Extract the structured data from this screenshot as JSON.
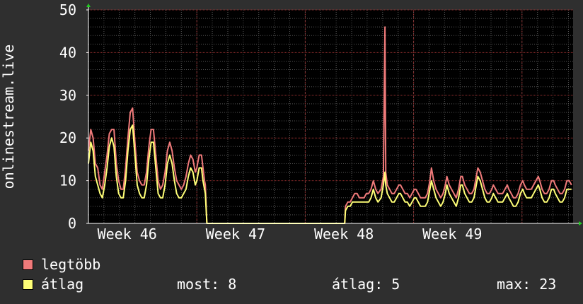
{
  "chart_data": {
    "type": "line",
    "ylabel": "onlinestream.live",
    "ylim": [
      0,
      50
    ],
    "yticks": [
      0,
      10,
      20,
      30,
      40,
      50
    ],
    "x_range": [
      0,
      28
    ],
    "week_ticks": [
      {
        "label": "Week 46",
        "x": 2.5
      },
      {
        "label": "Week 47",
        "x": 9.5
      },
      {
        "label": "Week 48",
        "x": 16.5
      },
      {
        "label": "Week 49",
        "x": 23.5
      }
    ],
    "grid": true,
    "series": [
      {
        "name": "legtöbb",
        "color": "#f07a7a",
        "points": [
          [
            0.0,
            17
          ],
          [
            0.15,
            22
          ],
          [
            0.3,
            20
          ],
          [
            0.45,
            14
          ],
          [
            0.6,
            13
          ],
          [
            0.75,
            9
          ],
          [
            0.9,
            8
          ],
          [
            1.05,
            12
          ],
          [
            1.2,
            16
          ],
          [
            1.35,
            21
          ],
          [
            1.5,
            22
          ],
          [
            1.65,
            22
          ],
          [
            1.8,
            14
          ],
          [
            1.95,
            10
          ],
          [
            2.1,
            8
          ],
          [
            2.25,
            8
          ],
          [
            2.4,
            13
          ],
          [
            2.55,
            20
          ],
          [
            2.7,
            26
          ],
          [
            2.85,
            27
          ],
          [
            3.0,
            19
          ],
          [
            3.15,
            12
          ],
          [
            3.3,
            10
          ],
          [
            3.45,
            9
          ],
          [
            3.6,
            9
          ],
          [
            3.75,
            12
          ],
          [
            3.9,
            18
          ],
          [
            4.05,
            22
          ],
          [
            4.2,
            22
          ],
          [
            4.35,
            16
          ],
          [
            4.5,
            10
          ],
          [
            4.65,
            8
          ],
          [
            4.8,
            9
          ],
          [
            4.95,
            12
          ],
          [
            5.1,
            17
          ],
          [
            5.25,
            19
          ],
          [
            5.4,
            17
          ],
          [
            5.55,
            13
          ],
          [
            5.7,
            10
          ],
          [
            5.85,
            9
          ],
          [
            6.0,
            8
          ],
          [
            6.15,
            9
          ],
          [
            6.3,
            11
          ],
          [
            6.45,
            14
          ],
          [
            6.6,
            16
          ],
          [
            6.75,
            15
          ],
          [
            6.9,
            12
          ],
          [
            7.0,
            13
          ],
          [
            7.15,
            16
          ],
          [
            7.3,
            16
          ],
          [
            7.4,
            13
          ],
          [
            7.5,
            10
          ],
          [
            7.55,
            9
          ],
          [
            7.65,
            0
          ],
          [
            8.0,
            0
          ],
          [
            10.0,
            0
          ],
          [
            12.0,
            0
          ],
          [
            14.0,
            0
          ],
          [
            16.0,
            0
          ],
          [
            16.55,
            0
          ],
          [
            16.6,
            4
          ],
          [
            16.75,
            5
          ],
          [
            16.9,
            5
          ],
          [
            17.05,
            6
          ],
          [
            17.2,
            7
          ],
          [
            17.35,
            7
          ],
          [
            17.5,
            6
          ],
          [
            17.65,
            6
          ],
          [
            17.8,
            6
          ],
          [
            17.95,
            7
          ],
          [
            18.1,
            7
          ],
          [
            18.25,
            8
          ],
          [
            18.4,
            10
          ],
          [
            18.55,
            8
          ],
          [
            18.7,
            7
          ],
          [
            18.9,
            8
          ],
          [
            19.05,
            11
          ],
          [
            19.15,
            46
          ],
          [
            19.2,
            12
          ],
          [
            19.3,
            9
          ],
          [
            19.45,
            8
          ],
          [
            19.6,
            7
          ],
          [
            19.75,
            7
          ],
          [
            19.9,
            8
          ],
          [
            20.05,
            9
          ],
          [
            20.15,
            9
          ],
          [
            20.3,
            8
          ],
          [
            20.45,
            7
          ],
          [
            20.6,
            7
          ],
          [
            20.75,
            6
          ],
          [
            20.9,
            7
          ],
          [
            21.05,
            8
          ],
          [
            21.15,
            8
          ],
          [
            21.3,
            7
          ],
          [
            21.45,
            6
          ],
          [
            21.6,
            6
          ],
          [
            21.75,
            6
          ],
          [
            21.9,
            7
          ],
          [
            22.05,
            10
          ],
          [
            22.15,
            13
          ],
          [
            22.3,
            10
          ],
          [
            22.45,
            8
          ],
          [
            22.6,
            7
          ],
          [
            22.75,
            6
          ],
          [
            22.9,
            7
          ],
          [
            23.05,
            9
          ],
          [
            23.15,
            11
          ],
          [
            23.3,
            9
          ],
          [
            23.45,
            8
          ],
          [
            23.6,
            7
          ],
          [
            23.75,
            6
          ],
          [
            23.9,
            8
          ],
          [
            24.05,
            11
          ],
          [
            24.15,
            11
          ],
          [
            24.3,
            9
          ],
          [
            24.45,
            8
          ],
          [
            24.6,
            7
          ],
          [
            24.75,
            7
          ],
          [
            24.9,
            8
          ],
          [
            25.05,
            11
          ],
          [
            25.15,
            13
          ],
          [
            25.3,
            12
          ],
          [
            25.45,
            10
          ],
          [
            25.6,
            8
          ],
          [
            25.75,
            7
          ],
          [
            25.9,
            7
          ],
          [
            26.05,
            8
          ],
          [
            26.15,
            9
          ],
          [
            26.3,
            8
          ],
          [
            26.45,
            7
          ],
          [
            26.6,
            7
          ],
          [
            26.75,
            7
          ],
          [
            26.9,
            8
          ],
          [
            27.05,
            9
          ],
          [
            27.15,
            8
          ],
          [
            27.3,
            7
          ],
          [
            27.45,
            6
          ],
          [
            27.6,
            6
          ],
          [
            27.75,
            7
          ],
          [
            27.9,
            9
          ],
          [
            28.05,
            10
          ],
          [
            28.15,
            9
          ],
          [
            28.3,
            8
          ],
          [
            28.45,
            8
          ],
          [
            28.6,
            8
          ],
          [
            28.75,
            9
          ],
          [
            28.9,
            10
          ],
          [
            29.05,
            11
          ],
          [
            29.15,
            10
          ],
          [
            29.3,
            8
          ],
          [
            29.45,
            7
          ],
          [
            29.6,
            7
          ],
          [
            29.75,
            8
          ],
          [
            29.9,
            10
          ],
          [
            30.05,
            10
          ],
          [
            30.15,
            9
          ],
          [
            30.3,
            8
          ],
          [
            30.45,
            7
          ],
          [
            30.6,
            7
          ],
          [
            30.75,
            8
          ],
          [
            30.9,
            10
          ],
          [
            31.05,
            10
          ],
          [
            31.2,
            9
          ]
        ]
      },
      {
        "name": "átlag",
        "color": "#ffff77",
        "points": [
          [
            0.0,
            14
          ],
          [
            0.15,
            19
          ],
          [
            0.3,
            17
          ],
          [
            0.45,
            11
          ],
          [
            0.6,
            9
          ],
          [
            0.75,
            7
          ],
          [
            0.9,
            6
          ],
          [
            1.05,
            9
          ],
          [
            1.2,
            13
          ],
          [
            1.35,
            18
          ],
          [
            1.5,
            20
          ],
          [
            1.65,
            18
          ],
          [
            1.8,
            11
          ],
          [
            1.95,
            7
          ],
          [
            2.1,
            6
          ],
          [
            2.25,
            6
          ],
          [
            2.4,
            10
          ],
          [
            2.55,
            17
          ],
          [
            2.7,
            22
          ],
          [
            2.85,
            23
          ],
          [
            3.0,
            16
          ],
          [
            3.15,
            9
          ],
          [
            3.3,
            7
          ],
          [
            3.45,
            6
          ],
          [
            3.6,
            6
          ],
          [
            3.75,
            9
          ],
          [
            3.9,
            15
          ],
          [
            4.05,
            19
          ],
          [
            4.2,
            19
          ],
          [
            4.35,
            13
          ],
          [
            4.5,
            7
          ],
          [
            4.65,
            6
          ],
          [
            4.8,
            6
          ],
          [
            4.95,
            9
          ],
          [
            5.1,
            14
          ],
          [
            5.25,
            16
          ],
          [
            5.4,
            14
          ],
          [
            5.55,
            10
          ],
          [
            5.7,
            7
          ],
          [
            5.85,
            6
          ],
          [
            6.0,
            6
          ],
          [
            6.15,
            7
          ],
          [
            6.3,
            8
          ],
          [
            6.45,
            11
          ],
          [
            6.6,
            13
          ],
          [
            6.75,
            12
          ],
          [
            6.9,
            9
          ],
          [
            7.0,
            10
          ],
          [
            7.15,
            13
          ],
          [
            7.3,
            13
          ],
          [
            7.4,
            10
          ],
          [
            7.5,
            8
          ],
          [
            7.55,
            7
          ],
          [
            7.65,
            0
          ],
          [
            8.0,
            0
          ],
          [
            10.0,
            0
          ],
          [
            12.0,
            0
          ],
          [
            14.0,
            0
          ],
          [
            16.0,
            0
          ],
          [
            16.55,
            0
          ],
          [
            16.6,
            3
          ],
          [
            16.75,
            4
          ],
          [
            16.9,
            4
          ],
          [
            17.05,
            5
          ],
          [
            17.2,
            5
          ],
          [
            17.35,
            5
          ],
          [
            17.5,
            5
          ],
          [
            17.65,
            5
          ],
          [
            17.8,
            5
          ],
          [
            17.95,
            5
          ],
          [
            18.1,
            5
          ],
          [
            18.25,
            6
          ],
          [
            18.4,
            8
          ],
          [
            18.55,
            6
          ],
          [
            18.7,
            5
          ],
          [
            18.9,
            6
          ],
          [
            19.05,
            9
          ],
          [
            19.15,
            12
          ],
          [
            19.2,
            9
          ],
          [
            19.3,
            7
          ],
          [
            19.45,
            6
          ],
          [
            19.6,
            5
          ],
          [
            19.75,
            5
          ],
          [
            19.9,
            6
          ],
          [
            20.05,
            7
          ],
          [
            20.15,
            7
          ],
          [
            20.3,
            6
          ],
          [
            20.45,
            5
          ],
          [
            20.6,
            5
          ],
          [
            20.75,
            4
          ],
          [
            20.9,
            5
          ],
          [
            21.05,
            6
          ],
          [
            21.15,
            6
          ],
          [
            21.3,
            5
          ],
          [
            21.45,
            4
          ],
          [
            21.6,
            4
          ],
          [
            21.75,
            4
          ],
          [
            21.9,
            5
          ],
          [
            22.05,
            8
          ],
          [
            22.15,
            10
          ],
          [
            22.3,
            8
          ],
          [
            22.45,
            6
          ],
          [
            22.6,
            5
          ],
          [
            22.75,
            4
          ],
          [
            22.9,
            5
          ],
          [
            23.05,
            7
          ],
          [
            23.15,
            9
          ],
          [
            23.3,
            7
          ],
          [
            23.45,
            6
          ],
          [
            23.6,
            5
          ],
          [
            23.75,
            4
          ],
          [
            23.9,
            6
          ],
          [
            24.05,
            9
          ],
          [
            24.15,
            9
          ],
          [
            24.3,
            7
          ],
          [
            24.45,
            6
          ],
          [
            24.6,
            5
          ],
          [
            24.75,
            5
          ],
          [
            24.9,
            6
          ],
          [
            25.05,
            9
          ],
          [
            25.15,
            11
          ],
          [
            25.3,
            10
          ],
          [
            25.45,
            8
          ],
          [
            25.6,
            6
          ],
          [
            25.75,
            5
          ],
          [
            25.9,
            5
          ],
          [
            26.05,
            6
          ],
          [
            26.15,
            7
          ],
          [
            26.3,
            6
          ],
          [
            26.45,
            5
          ],
          [
            26.6,
            5
          ],
          [
            26.75,
            5
          ],
          [
            26.9,
            6
          ],
          [
            27.05,
            7
          ],
          [
            27.15,
            6
          ],
          [
            27.3,
            5
          ],
          [
            27.45,
            4
          ],
          [
            27.6,
            4
          ],
          [
            27.75,
            5
          ],
          [
            27.9,
            7
          ],
          [
            28.05,
            8
          ],
          [
            28.15,
            7
          ],
          [
            28.3,
            6
          ],
          [
            28.45,
            6
          ],
          [
            28.6,
            6
          ],
          [
            28.75,
            7
          ],
          [
            28.9,
            8
          ],
          [
            29.05,
            9
          ],
          [
            29.15,
            8
          ],
          [
            29.3,
            6
          ],
          [
            29.45,
            5
          ],
          [
            29.6,
            5
          ],
          [
            29.75,
            6
          ],
          [
            29.9,
            8
          ],
          [
            30.05,
            8
          ],
          [
            30.15,
            7
          ],
          [
            30.3,
            6
          ],
          [
            30.45,
            5
          ],
          [
            30.6,
            5
          ],
          [
            30.75,
            6
          ],
          [
            30.9,
            8
          ],
          [
            31.05,
            8
          ],
          [
            31.2,
            8
          ]
        ]
      }
    ],
    "stats": {
      "most_label": "most: 8",
      "atlag_label": "átlag: 5",
      "max_label": "max: 23"
    }
  },
  "colors": {
    "background": "#2f2f2f",
    "plot_background": "#000000",
    "major_grid": "#9a3030",
    "minor_grid": "#555555"
  }
}
